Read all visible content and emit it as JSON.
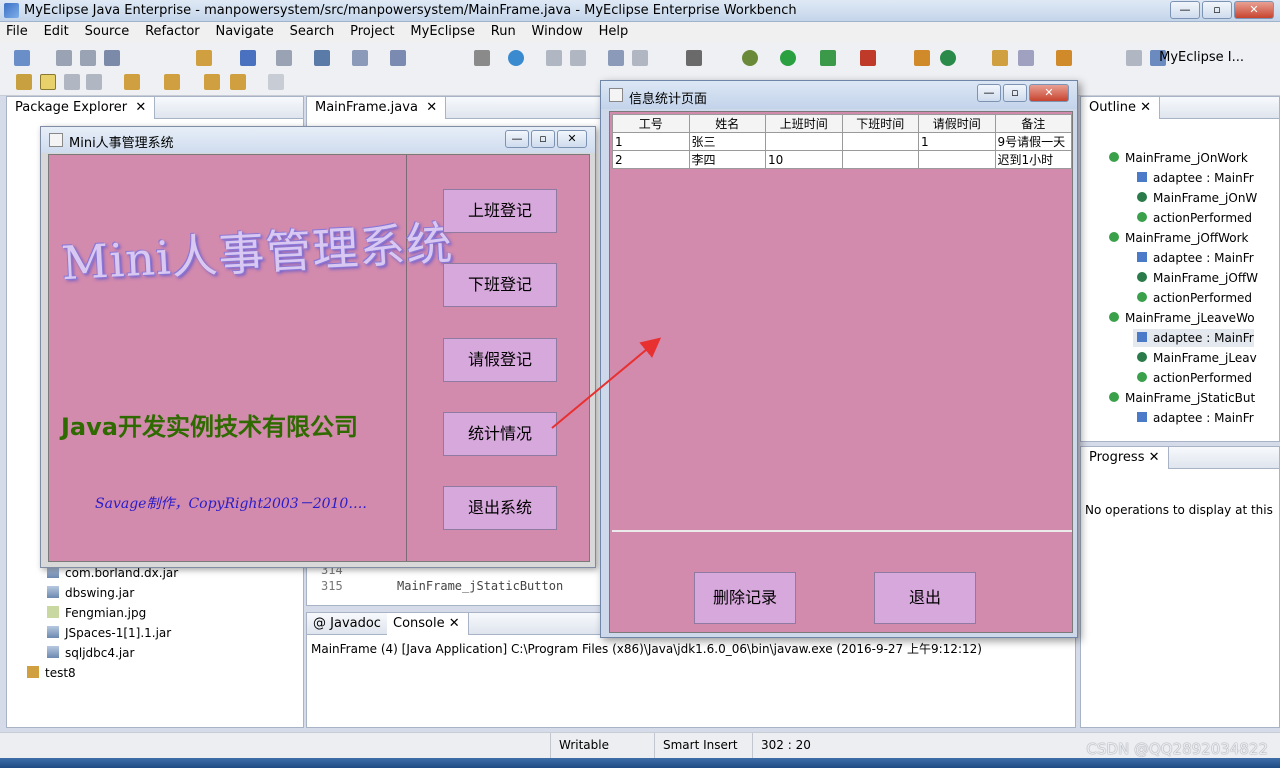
{
  "window": {
    "title": "MyEclipse Java Enterprise - manpowersystem/src/manpowersystem/MainFrame.java - MyEclipse Enterprise Workbench",
    "min": "—",
    "max": "▫",
    "close": "✕"
  },
  "menu": [
    "File",
    "Edit",
    "Source",
    "Refactor",
    "Navigate",
    "Search",
    "Project",
    "MyEclipse",
    "Run",
    "Window",
    "Help"
  ],
  "perspective": "MyEclipse I...",
  "package_explorer": {
    "tab": "Package Explorer",
    "items": [
      "com.borland.dx.jar",
      "dbswing.jar",
      "Fengmian.jpg",
      "JSpaces-1[1].1.jar",
      "sqljdbc4.jar",
      "test8"
    ]
  },
  "editor": {
    "tab": "MainFrame.java",
    "line_num_1": "314",
    "line_num_2": "315",
    "code": "MainFrame_jStaticButton"
  },
  "console": {
    "tab1": "Javadoc",
    "tab2": "Console",
    "text": "MainFrame (4) [Java Application] C:\\Program Files (x86)\\Java\\jdk1.6.0_06\\bin\\javaw.exe (2016-9-27 上午9:12:12)"
  },
  "outline": {
    "tab": "Outline",
    "items": [
      "MainFrame_jOnWork",
      "adaptee : MainFr",
      "MainFrame_jOnW",
      "actionPerformed",
      "MainFrame_jOffWork",
      "adaptee : MainFr",
      "MainFrame_jOffW",
      "actionPerformed",
      "MainFrame_jLeaveWo",
      "adaptee : MainFr",
      "MainFrame_jLeav",
      "actionPerformed",
      "MainFrame_jStaticBut",
      "adaptee : MainFr"
    ]
  },
  "progress": {
    "tab": "Progress",
    "message": "No operations to display at this"
  },
  "status": {
    "writable": "Writable",
    "insert": "Smart Insert",
    "position": "302 : 20"
  },
  "watermark": "CSDN @QQ2892034822",
  "mini_app": {
    "title": "Mini人事管理系统",
    "logo": "Mini人事管理系统",
    "company": "Java开发实例技术有限公司",
    "copyright": "Savage制作，CopyRight2003－2010….",
    "buttons": [
      "上班登记",
      "下班登记",
      "请假登记",
      "统计情况",
      "退出系统"
    ]
  },
  "stats_window": {
    "title": "信息统计页面",
    "columns": [
      "工号",
      "姓名",
      "上班时间",
      "下班时间",
      "请假时间",
      "备注"
    ],
    "rows": [
      [
        "1",
        "张三",
        "",
        "",
        "1",
        "9号请假一天"
      ],
      [
        "2",
        "李四",
        "10",
        "",
        "",
        "迟到1小时"
      ]
    ],
    "delete_button": "删除记录",
    "exit_button": "退出"
  },
  "colors": {
    "form_bg": "#d28aad",
    "button_bg": "#d7a8dc",
    "company_text": "#2f6a00",
    "copyright_text": "#2a1cc8",
    "arrow": "#e83030"
  }
}
